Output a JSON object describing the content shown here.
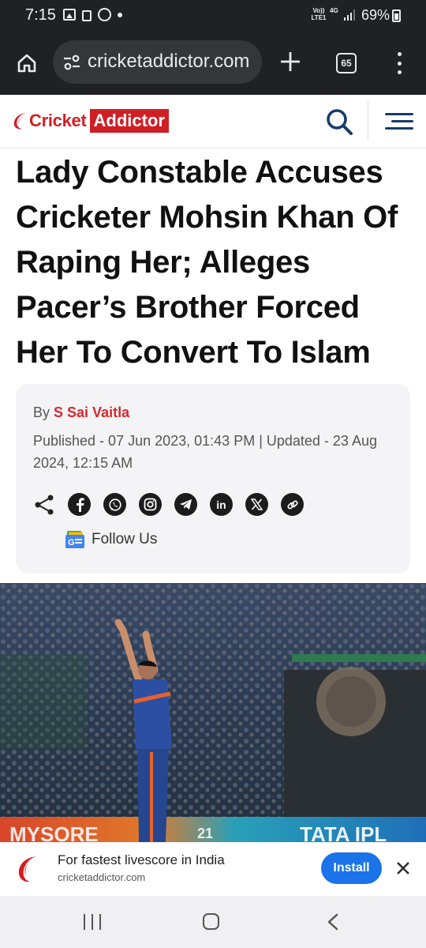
{
  "status_bar": {
    "time": "7:15",
    "volte": "Vo)) LTE1",
    "network": "4G",
    "battery": "69%"
  },
  "browser": {
    "url": "cricketaddictor.com",
    "tab_count": "65"
  },
  "site": {
    "brand_left": "Cricket",
    "brand_right": "Addictor",
    "brand_color": "#cf1f25"
  },
  "article": {
    "headline": "Lady Constable Accuses Cricketer Mohsin Khan Of Raping Her; Alleges Pacer’s Brother Forced Her To Convert To Islam",
    "by_prefix": "By",
    "author": "S Sai Vaitla",
    "published": "Published - 07 Jun 2023, 01:43 PM | Updated - 23 Aug 2024, 12:15 AM",
    "follow_label": "Follow Us",
    "share_icons": [
      "facebook-icon",
      "whatsapp-icon",
      "instagram-icon",
      "telegram-icon",
      "linkedin-icon",
      "x-icon",
      "link-icon"
    ]
  },
  "hero": {
    "banner_left": "MYSORE",
    "banner_mid": "21",
    "banner_right": "TATA IPL"
  },
  "install_banner": {
    "title": "For fastest livescore in India",
    "domain": "cricketaddictor.com",
    "button": "Install"
  }
}
